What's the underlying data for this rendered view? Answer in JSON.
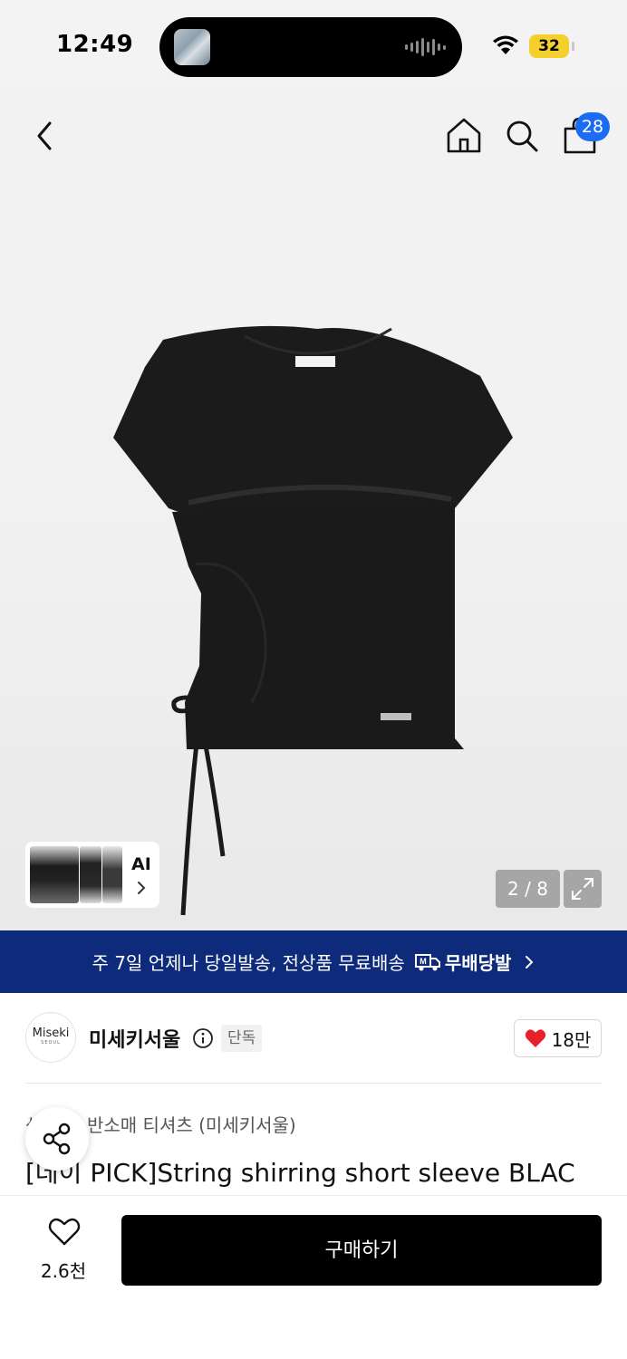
{
  "status_bar": {
    "time": "12:49",
    "battery": "32"
  },
  "nav": {
    "cart_count": "28"
  },
  "gallery": {
    "counter": "2 / 8",
    "ai_label": "AI"
  },
  "banner": {
    "text": "주 7일 언제나 당일발송, 전상품 무료배송",
    "logo_text": "무배당발"
  },
  "brand": {
    "logo_name": "Miseki",
    "logo_sub": "SEOUL",
    "name": "미세키서울",
    "badge": "단독",
    "favorites": "18만"
  },
  "product": {
    "category_prefix": "상의",
    "category": "반소매 티셔츠 (미세키서울)",
    "title": "[데이 PICK]String shirring short sleeve BLAC"
  },
  "bottom": {
    "likes": "2.6천",
    "buy_label": "구매하기"
  },
  "colors": {
    "accent_blue": "#1b6cf2",
    "banner_bg": "#0e2a7a",
    "heart_red": "#e8202a"
  }
}
